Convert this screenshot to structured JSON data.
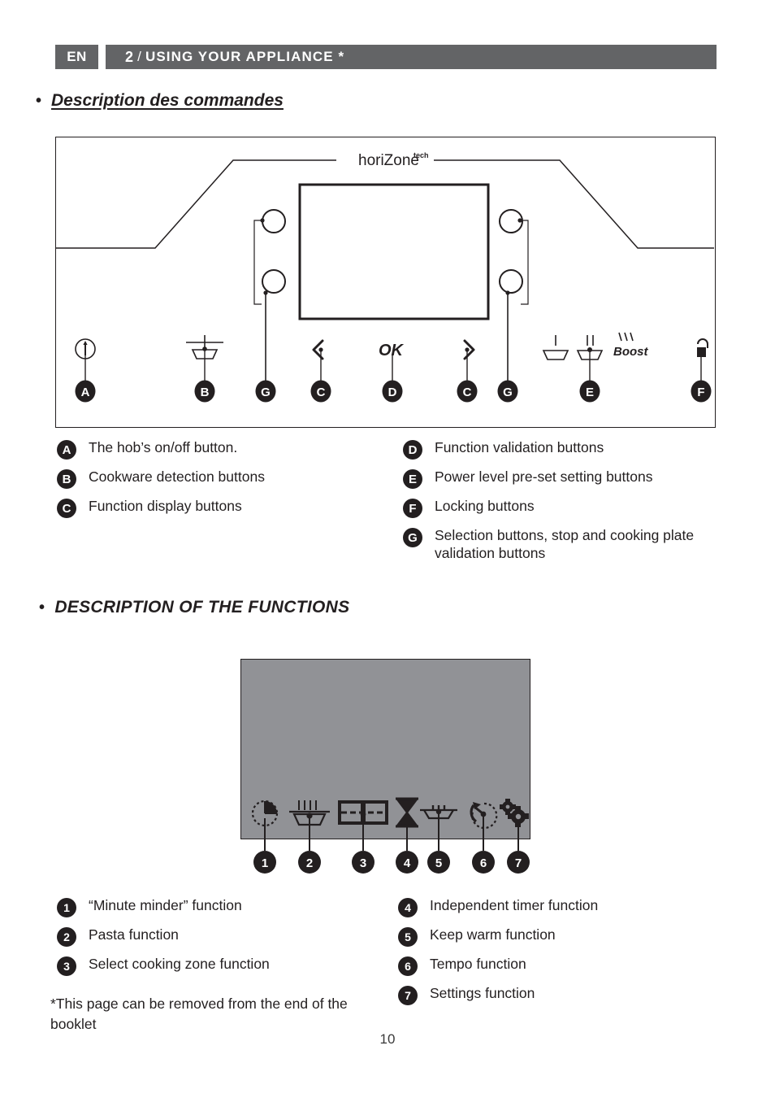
{
  "header": {
    "lang": "EN",
    "chapter_number": "2",
    "separator": "/",
    "title": "USING YOUR APPLIANCE *"
  },
  "sections": {
    "commands_heading": "Description des commandes",
    "functions_heading": "DESCRIPTION OF THE FUNCTIONS",
    "bullet": "•"
  },
  "control_panel": {
    "brand_label": "horiZone",
    "brand_superscript": "tech",
    "ok_label": "OK",
    "boost_label": "Boost",
    "callout_letters": [
      "A",
      "B",
      "G",
      "C",
      "D",
      "C",
      "G",
      "E",
      "F"
    ],
    "icons": [
      {
        "name": "power-on-off-icon",
        "letter": "A"
      },
      {
        "name": "cookware-detection-icon",
        "letter": "B"
      },
      {
        "name": "arrow-left-icon",
        "letter": "C"
      },
      {
        "name": "ok-validation-icon",
        "letter": "D"
      },
      {
        "name": "arrow-right-icon",
        "letter": "C"
      },
      {
        "name": "power-level-low-icon",
        "letter": "E"
      },
      {
        "name": "power-level-high-icon",
        "letter": "E"
      },
      {
        "name": "boost-icon",
        "letter": "E"
      },
      {
        "name": "lock-padlock-icon",
        "letter": "F"
      }
    ]
  },
  "panel_legend": [
    {
      "key": "A",
      "text": "The hob’s on/off button."
    },
    {
      "key": "B",
      "text": "Cookware detection buttons"
    },
    {
      "key": "C",
      "text": "Function display buttons"
    },
    {
      "key": "D",
      "text": "Function validation buttons"
    },
    {
      "key": "E",
      "text": "Power level pre-set setting buttons"
    },
    {
      "key": "F",
      "text": "Locking buttons"
    },
    {
      "key": "G",
      "text": "Selection buttons, stop and cooking plate validation buttons"
    }
  ],
  "functions_panel": {
    "background_color": "#919296",
    "callout_numbers": [
      "1",
      "2",
      "3",
      "4",
      "5",
      "6",
      "7"
    ],
    "icons": [
      {
        "name": "minute-minder-icon",
        "number": "1"
      },
      {
        "name": "pasta-pot-icon",
        "number": "2"
      },
      {
        "name": "select-cooking-zone-icon",
        "number": "3"
      },
      {
        "name": "hourglass-timer-icon",
        "number": "4"
      },
      {
        "name": "keep-warm-icon",
        "number": "5"
      },
      {
        "name": "tempo-icon",
        "number": "6"
      },
      {
        "name": "settings-gears-icon",
        "number": "7"
      }
    ]
  },
  "functions_legend": [
    {
      "key": "1",
      "text": "“Minute minder” function"
    },
    {
      "key": "2",
      "text": "Pasta function"
    },
    {
      "key": "3",
      "text": "Select cooking zone function"
    },
    {
      "key": "4",
      "text": "Independent timer function"
    },
    {
      "key": "5",
      "text": "Keep warm function"
    },
    {
      "key": "6",
      "text": "Tempo function"
    },
    {
      "key": "7",
      "text": "Settings function"
    }
  ],
  "footnote": "*This page can be removed from the end of the booklet",
  "page_number": "10"
}
